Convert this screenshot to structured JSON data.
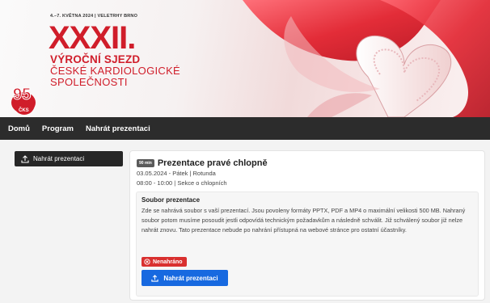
{
  "banner": {
    "event_date": "4.–7. KVĚTNA 2024  |  VELETRHY BRNO",
    "roman_numeral": "XXXII.",
    "title_line1": "VÝROČNÍ SJEZD",
    "title_line2": "ČESKÉ KARDIOLOGICKÉ",
    "title_line3": "SPOLEČNOSTI",
    "anniversary_number": "95",
    "anniversary_label": "ČKS"
  },
  "nav": {
    "items": [
      {
        "label": "Domů"
      },
      {
        "label": "Program"
      },
      {
        "label": "Nahrát prezentaci"
      }
    ]
  },
  "sidebar": {
    "upload_label": "Nahrát prezentaci"
  },
  "presentation": {
    "duration_badge": "90 min",
    "title": "Prezentace pravé chlopně",
    "date_line": "03.05.2024 - Pátek | Rotunda",
    "time_line": "08:00 - 10:00 | Sekce o chlopních",
    "file_section_title": "Soubor prezentace",
    "file_section_description": "Zde se nahrává soubor s vaší prezentací. Jsou povoleny formáty PPTX, PDF a MP4 o maximální velikosti 500 MB. Nahraný soubor potom musíme posoudit jestli odpovídá technickým požadavkům a následně schválit. Již schválený soubor již nelze nahrát znovu. Tato prezentace nebude po nahrání přístupná na webové stránce pro ostatní účastníky.",
    "status_label": "Nenahráno",
    "upload_button_label": "Nahrát prezentaci"
  },
  "colors": {
    "brand_red": "#d01d2a",
    "nav_bg": "#2c2c2c",
    "primary_blue": "#1769e0",
    "status_red": "#d9302f"
  }
}
